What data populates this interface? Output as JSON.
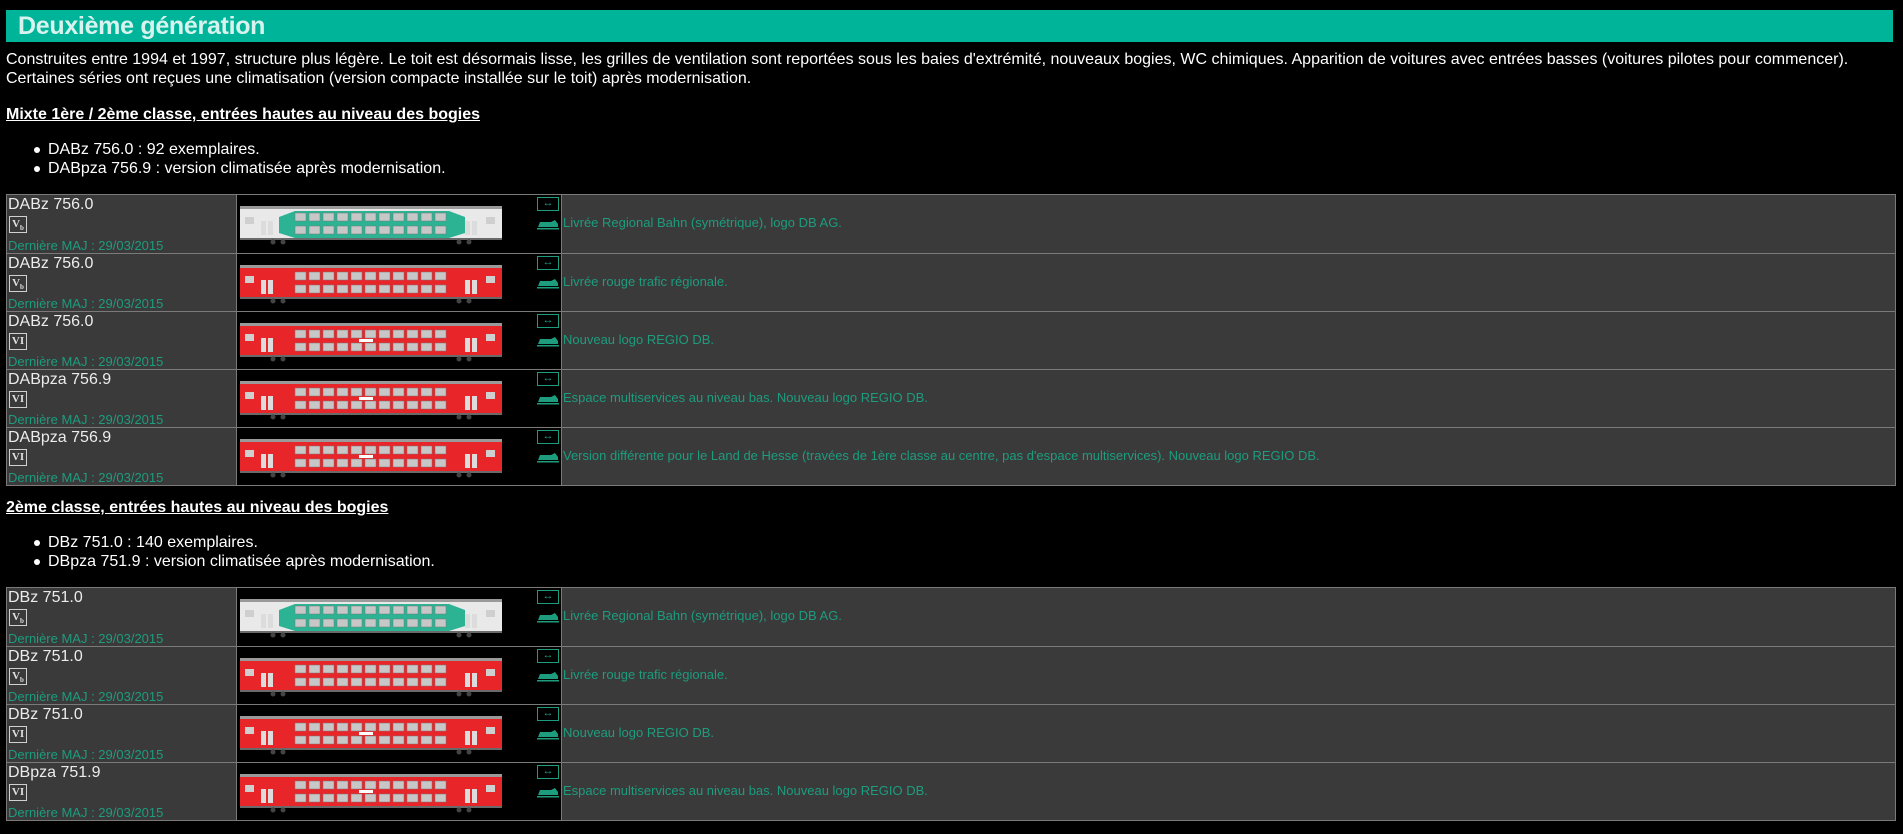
{
  "header": {
    "title": "Deuxième génération",
    "color": "#00b49a"
  },
  "intro": {
    "line1": "Construites entre 1994 et 1997, structure plus légère. Le toit est désormais lisse, les grilles de ventilation sont reportées sous les baies d'extrémité, nouveaux bogies, WC chimiques. Apparition de voitures avec entrées basses (voitures pilotes pour commencer).",
    "line2": "Certaines séries ont reçues une climatisation (version compacte installée sur le toit) après modernisation."
  },
  "sections": [
    {
      "title": "Mixte 1ère / 2ème classe, entrées hautes au niveau des bogies",
      "bullets": [
        "DABz 756.0 : 92 exemplaires.",
        "DABpza 756.9 : version climatisée après modernisation."
      ],
      "rows": [
        {
          "name": "DABz 756.0",
          "epoch": "Vb",
          "updated": "Dernière MAJ : 29/03/2015",
          "livery": "white-green",
          "description": "Livrée Regional Bahn (symétrique), logo DB AG."
        },
        {
          "name": "DABz 756.0",
          "epoch": "Vb",
          "updated": "Dernière MAJ : 29/03/2015",
          "livery": "red",
          "description": "Livrée rouge trafic régionale."
        },
        {
          "name": "DABz 756.0",
          "epoch": "VI",
          "updated": "Dernière MAJ : 29/03/2015",
          "livery": "red-regio",
          "description": "Nouveau logo REGIO DB."
        },
        {
          "name": "DABpza 756.9",
          "epoch": "VI",
          "updated": "Dernière MAJ : 29/03/2015",
          "livery": "red-regio",
          "description": "Espace multiservices au niveau bas. Nouveau logo REGIO DB."
        },
        {
          "name": "DABpza 756.9",
          "epoch": "VI",
          "updated": "Dernière MAJ : 29/03/2015",
          "livery": "red-regio",
          "description": "Version différente pour le Land de Hesse (travées de 1ère classe au centre, pas d'espace multiservices). Nouveau logo REGIO DB."
        }
      ]
    },
    {
      "title": "2ème classe, entrées hautes au niveau des bogies",
      "bullets": [
        "DBz 751.0 : 140 exemplaires.",
        "DBpza 751.9 : version climatisée après modernisation."
      ],
      "rows": [
        {
          "name": "DBz 751.0",
          "epoch": "Vb",
          "updated": "Dernière MAJ : 29/03/2015",
          "livery": "white-green",
          "description": "Livrée Regional Bahn (symétrique), logo DB AG."
        },
        {
          "name": "DBz 751.0",
          "epoch": "Vb",
          "updated": "Dernière MAJ : 29/03/2015",
          "livery": "red",
          "description": "Livrée rouge trafic régionale."
        },
        {
          "name": "DBz 751.0",
          "epoch": "VI",
          "updated": "Dernière MAJ : 29/03/2015",
          "livery": "red-regio",
          "description": "Nouveau logo REGIO DB."
        },
        {
          "name": "DBpza 751.9",
          "epoch": "VI",
          "updated": "Dernière MAJ : 29/03/2015",
          "livery": "red-regio",
          "description": "Espace multiservices au niveau bas. Nouveau logo REGIO DB."
        }
      ]
    }
  ],
  "icons": {
    "swap": "swap-arrows-icon",
    "loco": "locomotive-icon"
  },
  "colors": {
    "link": "#1d9c7e",
    "red": "#e8262a",
    "green": "#2bb394",
    "table_bg": "#3a3a3a"
  }
}
